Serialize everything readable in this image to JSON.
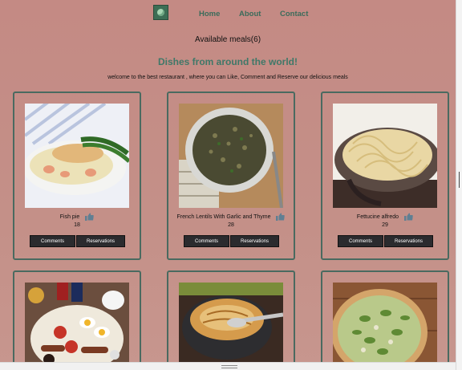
{
  "nav": {
    "links": [
      {
        "label": "Home"
      },
      {
        "label": "About"
      },
      {
        "label": "Contact"
      }
    ]
  },
  "meals": {
    "count_label": "Available meals(6)",
    "title": "Dishes from around the world!",
    "welcome": "welcome to the best restaurant , where you can Like, Comment and Reserve our delicious meals"
  },
  "cards": [
    {
      "name": "Fish pie",
      "likes": "18",
      "comments_label": "Comments",
      "reservations_label": "Reservations"
    },
    {
      "name": "French Lentils With Garlic and Thyme",
      "likes": "28",
      "comments_label": "Comments",
      "reservations_label": "Reservations"
    },
    {
      "name": "Fettucine alfredo",
      "likes": "29",
      "comments_label": "Comments",
      "reservations_label": "Reservations"
    },
    {
      "name": "",
      "likes": ""
    },
    {
      "name": "",
      "likes": ""
    },
    {
      "name": "",
      "likes": ""
    }
  ],
  "icons": {
    "logo": "leaf-logo-icon",
    "like": "thumbs-up-icon"
  },
  "colors": {
    "background": "#c48a84",
    "accent": "#3f7868",
    "button": "#2b2b2e",
    "card_border": "#4a6a60"
  }
}
